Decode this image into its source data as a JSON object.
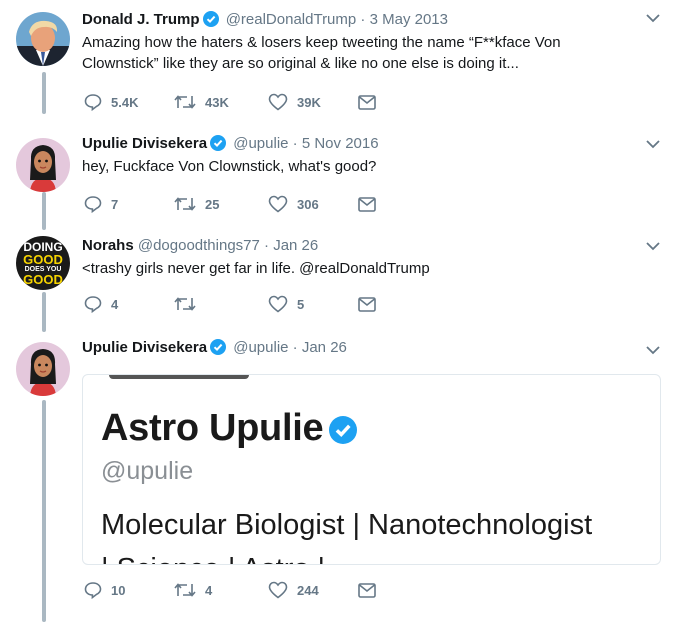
{
  "colors": {
    "accent": "#1da1f2",
    "muted": "#657786",
    "thread_line": "#aab8c2"
  },
  "tweets": [
    {
      "name": "Donald J. Trump",
      "handle": "@realDonaldTrump",
      "sep": "·",
      "date": "3 May 2013",
      "text": "Amazing how the haters & losers keep tweeting the name “F**kface Von Clownstick” like they are so original & like no one else is doing it...",
      "avatar_icon": "trump-avatar",
      "replies": "5.4K",
      "retweets": "43K",
      "likes": "39K"
    },
    {
      "name": "Upulie Divisekera",
      "handle": "@upulie",
      "sep": "·",
      "date": "5 Nov 2016",
      "text": "hey, Fuckface Von Clownstick, what's good?",
      "avatar_icon": "cartoon-woman-avatar",
      "replies": "7",
      "retweets": "25",
      "likes": "306"
    },
    {
      "name": "Norahs",
      "handle": "@dogoodthings77",
      "sep": "·",
      "date": "Jan 26",
      "text": "<trashy girls never get far in life.  @realDonaldTrump",
      "avatar_icon": "doing-good-logo-avatar",
      "avatar_text": [
        "DOING",
        "GOOD",
        "DOES YOU",
        "GOOD"
      ],
      "replies": "4",
      "retweets": "",
      "likes": "5"
    },
    {
      "name": "Upulie Divisekera",
      "handle": "@upulie",
      "sep": "·",
      "date": "Jan 26",
      "text": "",
      "avatar_icon": "cartoon-woman-avatar",
      "replies": "10",
      "retweets": "4",
      "likes": "244"
    }
  ],
  "card": {
    "title": "Astro Upulie",
    "handle": "@upulie",
    "bio": "Molecular Biologist | Nanotechnologist",
    "bio_cut": "| Science | Astro | ..."
  }
}
